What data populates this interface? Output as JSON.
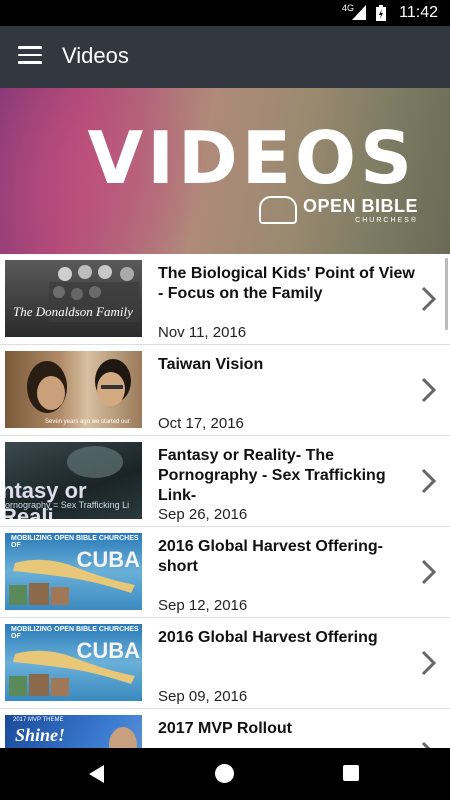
{
  "status_bar": {
    "time": "11:42",
    "network": "4G"
  },
  "app_bar": {
    "title": "Videos"
  },
  "banner": {
    "heading": "VIDEOS",
    "logo_text": "OPEN BIBLE",
    "logo_subtext": "CHURCHES®"
  },
  "videos": [
    {
      "title": "The Biological Kids' Point of View - Focus on the Family",
      "date": "Nov 11, 2016",
      "thumb_caption": "The Donaldson Family"
    },
    {
      "title": "Taiwan Vision",
      "date": "Oct 17, 2016",
      "thumb_caption": "Seven years ago we started our"
    },
    {
      "title": "Fantasy or Reality- The Pornography - Sex Trafficking Link-",
      "date": "Sep 26, 2016",
      "thumb_caption": "ntasy or Reali",
      "thumb_subcaption": "ornography = Sex Trafficking Li"
    },
    {
      "title": "2016 Global Harvest Offering-short",
      "date": "Sep 12, 2016",
      "thumb_caption": "MOBILIZING OPEN BIBLE CHURCHES OF",
      "thumb_word": "CUBA"
    },
    {
      "title": "2016 Global Harvest Offering",
      "date": "Sep 09, 2016",
      "thumb_caption": "MOBILIZING OPEN BIBLE CHURCHES OF",
      "thumb_word": "CUBA"
    },
    {
      "title": "2017 MVP Rollout",
      "date": "",
      "thumb_caption": "2017 MVP THEME",
      "thumb_word": "Shine!"
    }
  ]
}
